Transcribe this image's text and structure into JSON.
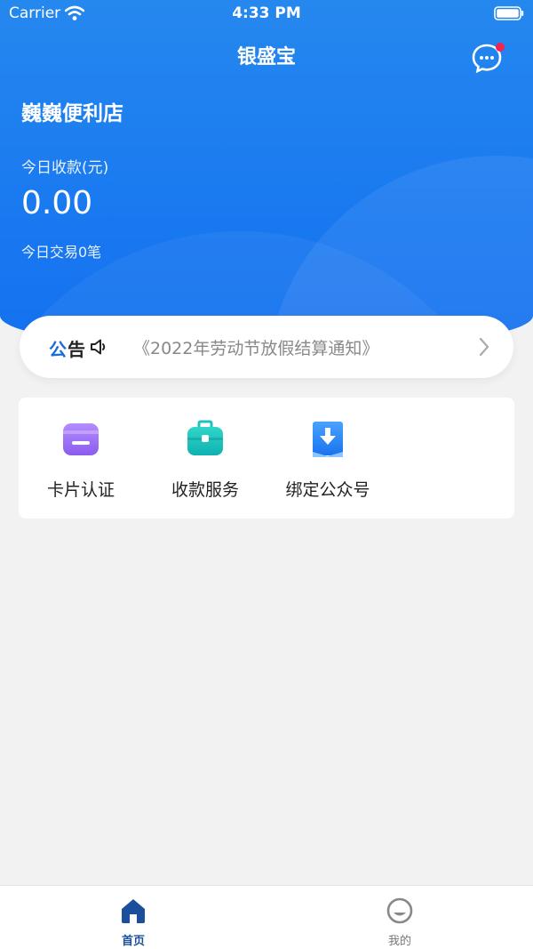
{
  "status_bar": {
    "carrier": "Carrier",
    "time": "4:33 PM"
  },
  "nav": {
    "title": "银盛宝"
  },
  "summary": {
    "store_name": "巍巍便利店",
    "today_label": "今日收款(元)",
    "today_amount": "0.00",
    "today_count": "今日交易0笔"
  },
  "notice": {
    "tag_part1": "公",
    "tag_part2": "告",
    "text": "《2022年劳动节放假结算通知》"
  },
  "services": [
    {
      "label": "卡片认证",
      "icon": "card-icon"
    },
    {
      "label": "收款服务",
      "icon": "toolbox-icon"
    },
    {
      "label": "绑定公众号",
      "icon": "download-book-icon"
    }
  ],
  "tabs": [
    {
      "label": "首页",
      "icon": "home-icon",
      "active": true
    },
    {
      "label": "我的",
      "icon": "profile-icon",
      "active": false
    }
  ],
  "colors": {
    "primary": "#1a7af0",
    "active_tab": "#1b4f9c",
    "inactive_tab": "#888888",
    "badge": "#f5234f"
  }
}
